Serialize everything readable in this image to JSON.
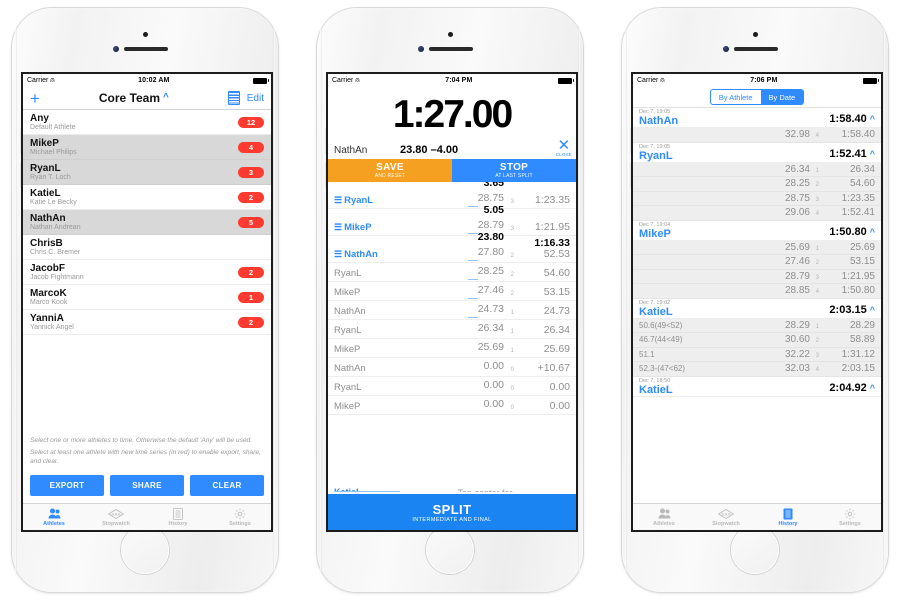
{
  "phone1": {
    "status": {
      "carrier": "Carrier",
      "wifi": "wifi-icon",
      "time": "10:02 AM"
    },
    "nav": {
      "add": "+",
      "title": "Core Team",
      "caret": "^",
      "list_icon": "list-icon",
      "edit": "Edit"
    },
    "athletes": [
      {
        "name": "Any",
        "sub": "Default Athlete",
        "badge": "12",
        "selected": false
      },
      {
        "name": "MikeP",
        "sub": "Michael Philips",
        "badge": "4",
        "selected": true
      },
      {
        "name": "RyanL",
        "sub": "Ryan T. Loch",
        "badge": "3",
        "selected": true
      },
      {
        "name": "KatieL",
        "sub": "Katie Le Becky",
        "badge": "2",
        "selected": false
      },
      {
        "name": "NathAn",
        "sub": "Nathan Andrean",
        "badge": "5",
        "selected": true
      },
      {
        "name": "ChrisB",
        "sub": "Chris C. Bremer",
        "badge": "",
        "selected": false
      },
      {
        "name": "JacobF",
        "sub": "Jacob Fightmann",
        "badge": "2",
        "selected": false
      },
      {
        "name": "MarcoK",
        "sub": "Marco Kook",
        "badge": "1",
        "selected": false
      },
      {
        "name": "YanniA",
        "sub": "Yannick Angel",
        "badge": "2",
        "selected": false
      }
    ],
    "hints": [
      "Select one or more athletes to time. Otherwise the default 'Any' will be used.",
      "Select at least one athlete with new time series (in red) to enable export, share, and clear."
    ],
    "actions": {
      "export": "EXPORT",
      "share": "SHARE",
      "clear": "CLEAR"
    },
    "tabs": [
      {
        "label": "Athletes",
        "icon": "athletes-icon",
        "active": true
      },
      {
        "label": "Stopwatch",
        "icon": "stopwatch-icon",
        "active": false
      },
      {
        "label": "History",
        "icon": "history-icon",
        "active": false
      },
      {
        "label": "Settings",
        "icon": "settings-icon",
        "active": false
      }
    ]
  },
  "phone2": {
    "status": {
      "carrier": "Carrier",
      "wifi": "wifi-icon",
      "time": "7:04 PM"
    },
    "timer": "1:27.00",
    "current": {
      "name": "NathAn",
      "value": "23.80 –4.00"
    },
    "close": {
      "glyph": "✕",
      "label": "CLOSE"
    },
    "buttons": {
      "save_title": "SAVE",
      "save_sub": "AND RESET",
      "stop_title": "STOP",
      "stop_sub": "AT LAST SPLIT"
    },
    "splits": [
      {
        "name": "RyanL",
        "active": true,
        "top": "3.65",
        "lap": "28.75",
        "idx": "3",
        "total": "1:23.35",
        "total_bold": "",
        "underline": true
      },
      {
        "name": "MikeP",
        "active": true,
        "top": "5.05",
        "lap": "28.79",
        "idx": "3",
        "total": "1:21.95",
        "total_bold": "",
        "underline": true
      },
      {
        "name": "NathAn",
        "active": true,
        "top": "23.80",
        "lap": "27.80",
        "idx": "2",
        "total": "52.53",
        "total_bold": "1:16.33",
        "underline": true
      },
      {
        "name": "RyanL",
        "active": false,
        "top": "",
        "lap": "28.25",
        "idx": "2",
        "total": "54.60",
        "total_bold": "",
        "underline": true
      },
      {
        "name": "MikeP",
        "active": false,
        "top": "",
        "lap": "27.46",
        "idx": "2",
        "total": "53.15",
        "total_bold": "",
        "underline": true
      },
      {
        "name": "NathAn",
        "active": false,
        "top": "",
        "lap": "24.73",
        "idx": "1",
        "total": "24.73",
        "total_bold": "",
        "underline": true
      },
      {
        "name": "RyanL",
        "active": false,
        "top": "",
        "lap": "26.34",
        "idx": "1",
        "total": "26.34",
        "total_bold": "",
        "underline": false
      },
      {
        "name": "MikeP",
        "active": false,
        "top": "",
        "lap": "25.69",
        "idx": "1",
        "total": "25.69",
        "total_bold": "",
        "underline": false
      },
      {
        "name": "NathAn",
        "active": false,
        "top": "",
        "lap": "0.00",
        "idx": "0",
        "total": "+10.67",
        "total_bold": "",
        "underline": false
      },
      {
        "name": "RyanL",
        "active": false,
        "top": "",
        "lap": "0.00",
        "idx": "0",
        "total": "0.00",
        "total_bold": "",
        "underline": false
      },
      {
        "name": "MikeP",
        "active": false,
        "top": "",
        "lap": "0.00",
        "idx": "0",
        "total": "0.00",
        "total_bold": "",
        "underline": false
      }
    ],
    "cut_row": {
      "name": "KatieL",
      "hint": "Tap center for"
    },
    "split_button": {
      "title": "SPLIT",
      "sub": "INTERMEDIATE AND FINAL"
    }
  },
  "phone3": {
    "status": {
      "carrier": "Carrier",
      "wifi": "wifi-icon",
      "time": "7:06 PM"
    },
    "segment": {
      "left": "By Athlete",
      "right": "By Date",
      "selected": "By Date"
    },
    "groups": [
      {
        "date": "Dec 7, 19:05",
        "name": "NathAn",
        "total": "1:58.40",
        "caret": "^",
        "rows": [
          {
            "note": "",
            "lap": "32.98",
            "idx": "4",
            "total": "1:58.40"
          }
        ]
      },
      {
        "date": "Dec 7, 19:05",
        "name": "RyanL",
        "total": "1:52.41",
        "caret": "^",
        "rows": [
          {
            "note": "",
            "lap": "26.34",
            "idx": "1",
            "total": "26.34"
          },
          {
            "note": "",
            "lap": "28.25",
            "idx": "2",
            "total": "54.60"
          },
          {
            "note": "",
            "lap": "28.75",
            "idx": "3",
            "total": "1:23.35"
          },
          {
            "note": "",
            "lap": "29.06",
            "idx": "4",
            "total": "1:52.41"
          }
        ]
      },
      {
        "date": "Dec 7, 19:04",
        "name": "MikeP",
        "total": "1:50.80",
        "caret": "^",
        "rows": [
          {
            "note": "",
            "lap": "25.69",
            "idx": "1",
            "total": "25.69"
          },
          {
            "note": "",
            "lap": "27.46",
            "idx": "2",
            "total": "53.15"
          },
          {
            "note": "",
            "lap": "28.79",
            "idx": "3",
            "total": "1:21.95"
          },
          {
            "note": "",
            "lap": "28.85",
            "idx": "4",
            "total": "1:50.80"
          }
        ]
      },
      {
        "date": "Dec 7, 19:02",
        "name": "KatieL",
        "total": "2:03.15",
        "caret": "^",
        "rows": [
          {
            "note": "50.6(49<52)",
            "lap": "28.29",
            "idx": "1",
            "total": "28.29"
          },
          {
            "note": "46.7(44<49)",
            "lap": "30.60",
            "idx": "2",
            "total": "58.89"
          },
          {
            "note": "51.1",
            "lap": "32.22",
            "idx": "3",
            "total": "1:31.12"
          },
          {
            "note": "52.3-(47<62)",
            "lap": "32.03",
            "idx": "4",
            "total": "2:03.15"
          }
        ]
      },
      {
        "date": "Dec 7, 18:50",
        "name": "KatieL",
        "total": "2:04.92",
        "caret": "^",
        "rows": []
      }
    ],
    "tabs": [
      {
        "label": "Athletes",
        "icon": "athletes-icon",
        "active": false
      },
      {
        "label": "Stopwatch",
        "icon": "stopwatch-icon",
        "active": false
      },
      {
        "label": "History",
        "icon": "history-icon",
        "active": true
      },
      {
        "label": "Settings",
        "icon": "settings-icon",
        "active": false
      }
    ]
  }
}
